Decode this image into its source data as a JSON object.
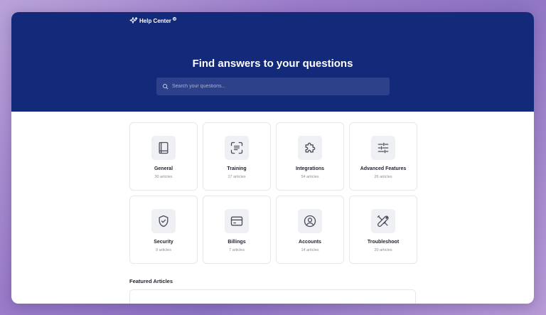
{
  "brand": {
    "name": "Help Center",
    "badge": "®"
  },
  "hero": {
    "title": "Find answers to your questions",
    "search_placeholder": "Search your questions..."
  },
  "categories": [
    {
      "title": "General",
      "count": "30 articles",
      "icon": "book-icon"
    },
    {
      "title": "Training",
      "count": "17 articles",
      "icon": "scan-text-icon"
    },
    {
      "title": "Integrations",
      "count": "54 articles",
      "icon": "puzzle-icon"
    },
    {
      "title": "Advanced Features",
      "count": "26 articles",
      "icon": "sliders-icon"
    },
    {
      "title": "Security",
      "count": "9 articles",
      "icon": "shield-check-icon"
    },
    {
      "title": "Billings",
      "count": "7 articles",
      "icon": "credit-card-icon"
    },
    {
      "title": "Accounts",
      "count": "14 articles",
      "icon": "user-circle-icon"
    },
    {
      "title": "Troubleshoot",
      "count": "20 articles",
      "icon": "tools-icon"
    }
  ],
  "featured": {
    "title": "Featured Articles"
  },
  "colors": {
    "hero_bg": "#13297a",
    "page_bg": "#9a7cc9",
    "icon_stroke": "#4a4f5c"
  }
}
